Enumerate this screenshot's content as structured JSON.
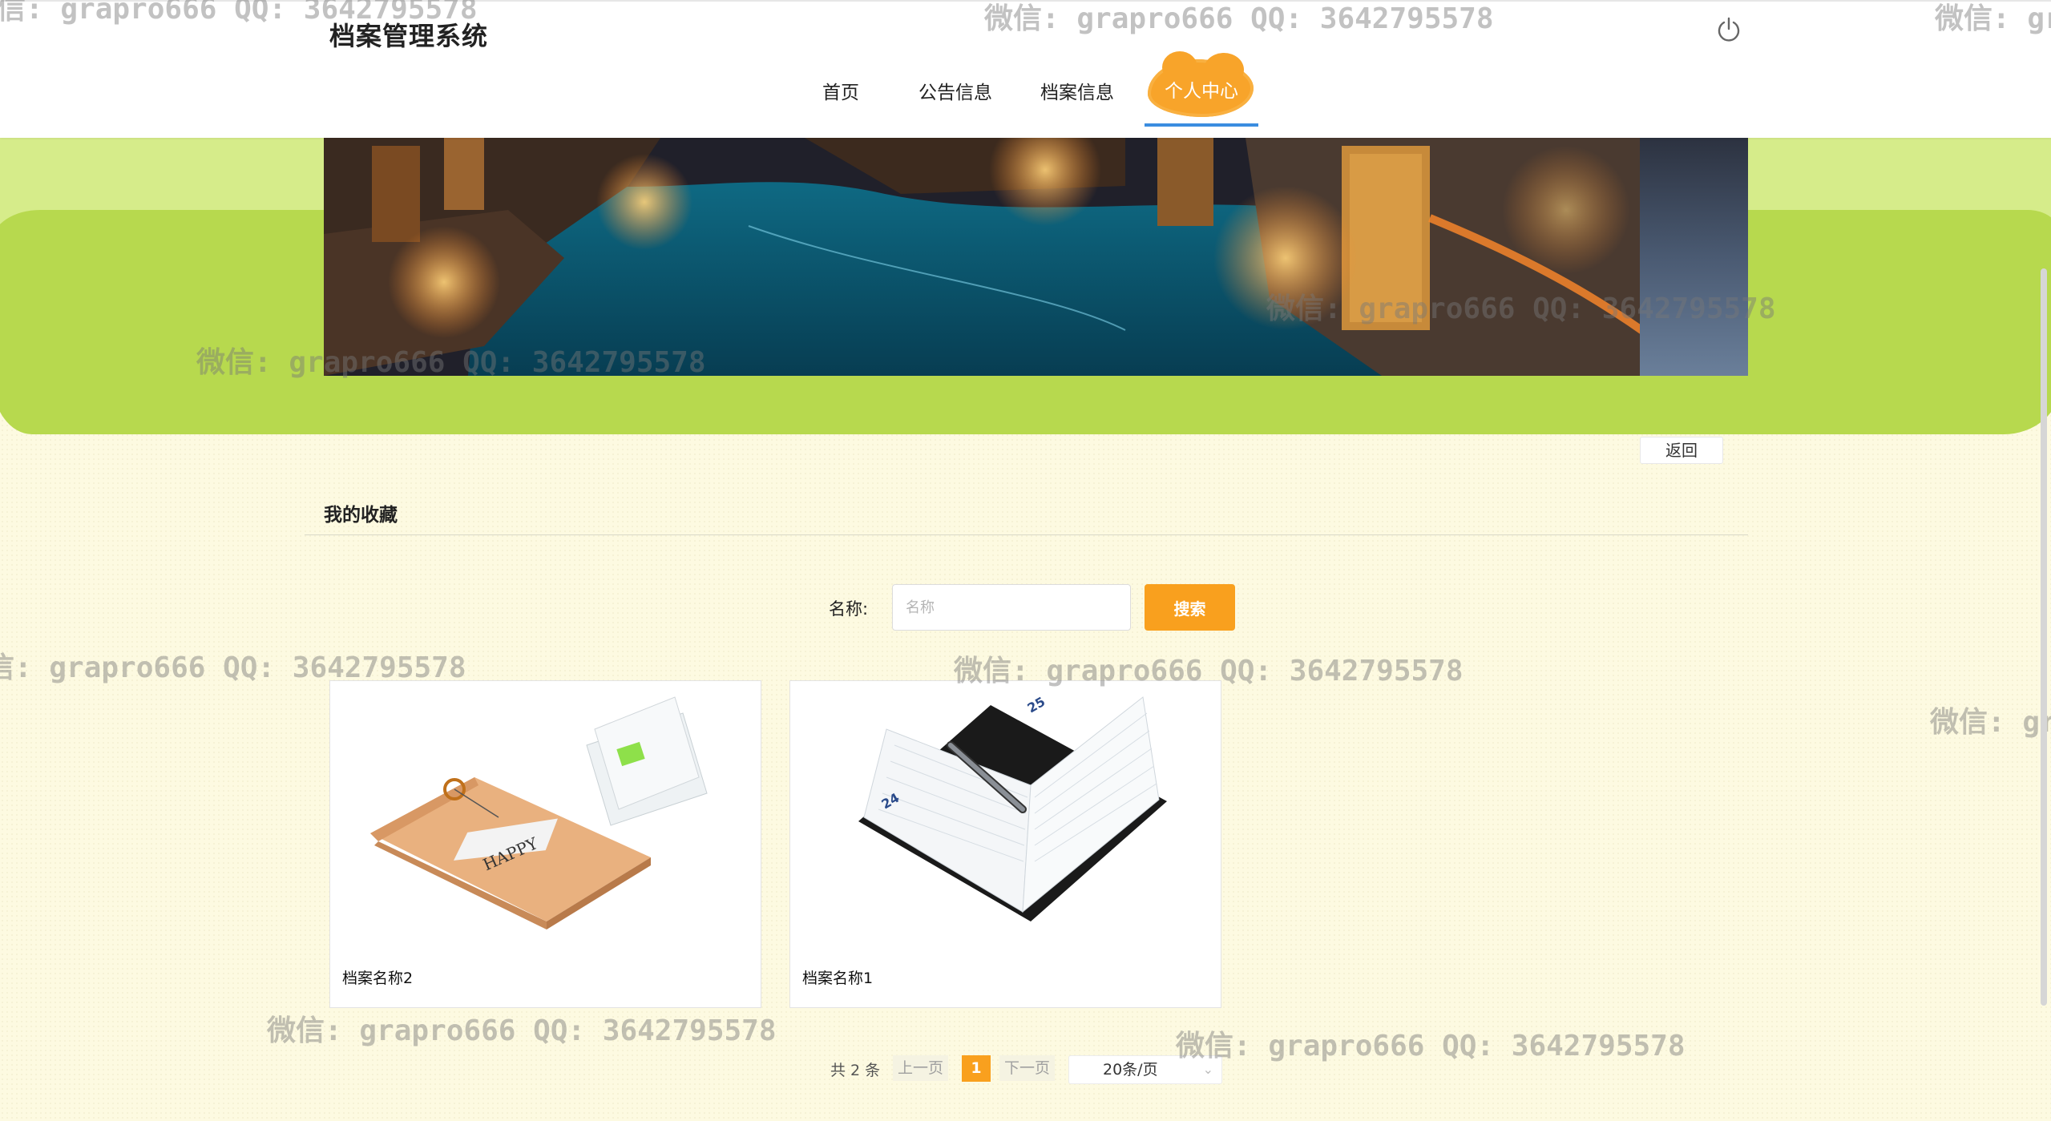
{
  "header": {
    "title": "档案管理系统",
    "nav": [
      {
        "label": "首页"
      },
      {
        "label": "公告信息"
      },
      {
        "label": "档案信息"
      },
      {
        "label": "个人中心"
      }
    ]
  },
  "icons": {
    "power": "power-icon"
  },
  "colors": {
    "accent": "#f9a01e",
    "nav_underline": "#3b8de0",
    "green_band": "#b7d94e"
  },
  "back_label": "返回",
  "section": {
    "title": "我的收藏"
  },
  "search": {
    "label": "名称:",
    "placeholder": "名称",
    "button": "搜索"
  },
  "cards": [
    {
      "name": "档案名称2",
      "image": "envelope-image"
    },
    {
      "name": "档案名称1",
      "image": "notebook-image"
    }
  ],
  "pagination": {
    "total": "共 2 条",
    "prev": "上一页",
    "current": "1",
    "next": "下一页",
    "page_size": "20条/页"
  },
  "watermark": "微信: grapro666 QQ: 3642795578"
}
